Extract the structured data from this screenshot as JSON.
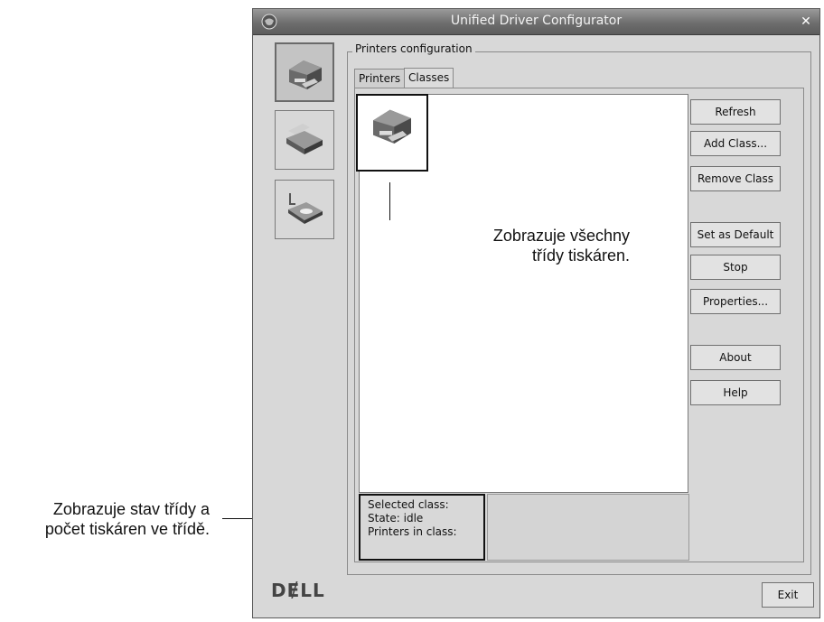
{
  "window": {
    "title": "Unified Driver Configurator"
  },
  "sidebar": {
    "items": [
      {
        "name": "printers",
        "icon": "printer-icon"
      },
      {
        "name": "scanners",
        "icon": "scanner-icon"
      },
      {
        "name": "ports",
        "icon": "port-icon"
      }
    ]
  },
  "printers_config": {
    "group_title": "Printers configuration",
    "tabs": [
      "Printers",
      "Classes"
    ],
    "active_tab": "Classes"
  },
  "buttons": {
    "refresh": "Refresh",
    "add_class": "Add Class...",
    "remove_class": "Remove Class",
    "set_default": "Set as Default",
    "stop": "Stop",
    "properties": "Properties...",
    "about": "About",
    "help": "Help",
    "exit": "Exit"
  },
  "class_info": {
    "selected_class": "Selected class:",
    "state": "State: idle",
    "printers_in_class": "Printers in class:"
  },
  "logo_text": "DɆLL",
  "annotations": {
    "list_callout_line1": "Zobrazuje všechny",
    "list_callout_line2": "třídy tiskáren.",
    "status_callout_line1": "Zobrazuje stav třídy a",
    "status_callout_line2": "počet tiskáren ve třídě."
  }
}
